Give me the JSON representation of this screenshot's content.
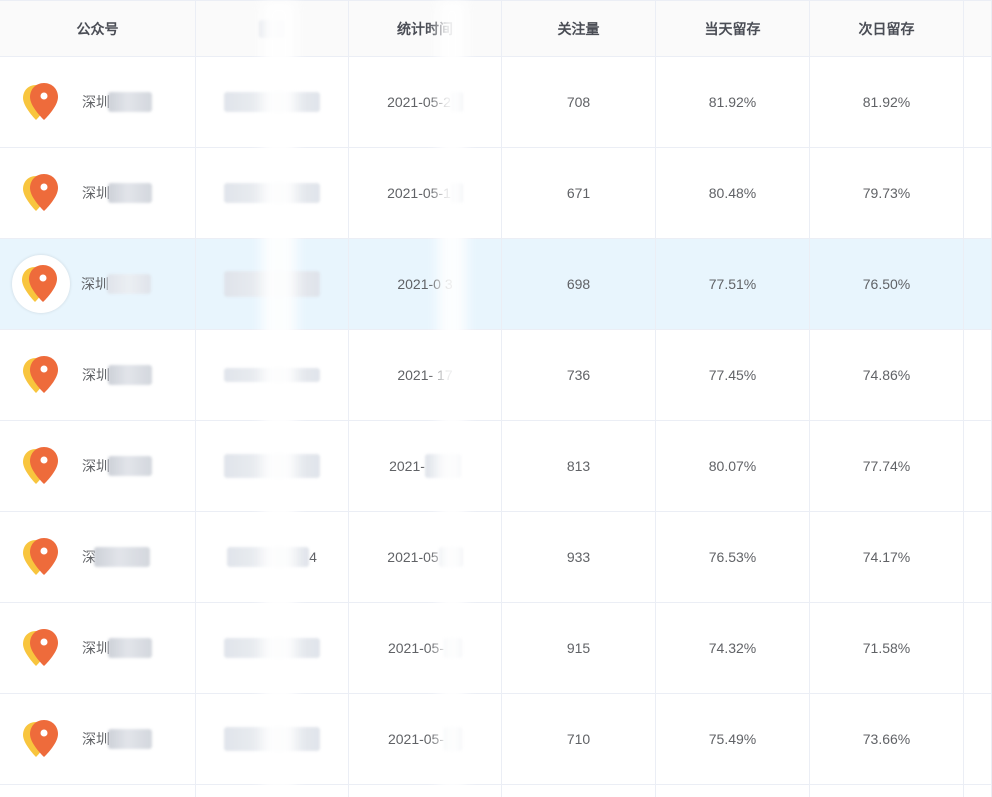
{
  "table": {
    "headers": [
      "公众号",
      "",
      "统计时间",
      "关注量",
      "当天留存",
      "次日留存",
      ""
    ],
    "rows": [
      {
        "account": "深圳",
        "col2": "",
        "date": "2021-05-2",
        "followers": "708",
        "today_retention": "81.92%",
        "next_day_retention": "81.92%"
      },
      {
        "account": "深圳",
        "col2": "",
        "date": "2021-05-1",
        "followers": "671",
        "today_retention": "80.48%",
        "next_day_retention": "79.73%"
      },
      {
        "account": "深圳",
        "col2": "",
        "date": "2021-0  3",
        "followers": "698",
        "today_retention": "77.51%",
        "next_day_retention": "76.50%"
      },
      {
        "account": "深圳",
        "col2": "",
        "date": "2021-    17",
        "followers": "736",
        "today_retention": "77.45%",
        "next_day_retention": "74.86%"
      },
      {
        "account": "深圳",
        "col2": "",
        "date": "2021-",
        "followers": "813",
        "today_retention": "80.07%",
        "next_day_retention": "77.74%"
      },
      {
        "account": "深",
        "col2": "4",
        "date": "2021-05",
        "followers": "933",
        "today_retention": "76.53%",
        "next_day_retention": "74.17%"
      },
      {
        "account": "深圳",
        "col2": "",
        "date": "2021-05-",
        "followers": "915",
        "today_retention": "74.32%",
        "next_day_retention": "71.58%"
      },
      {
        "account": "深圳",
        "col2": "",
        "date": "2021-05-",
        "followers": "710",
        "today_retention": "75.49%",
        "next_day_retention": "73.66%"
      }
    ]
  },
  "colors": {
    "header_bg": "#fafafa",
    "border": "#ebeef5",
    "row_hover": "#e8f5fd",
    "pin_orange": "#ee6b3b",
    "pin_yellow": "#f8c53e"
  },
  "icons": {
    "account_logo": "location-pin-icon"
  }
}
